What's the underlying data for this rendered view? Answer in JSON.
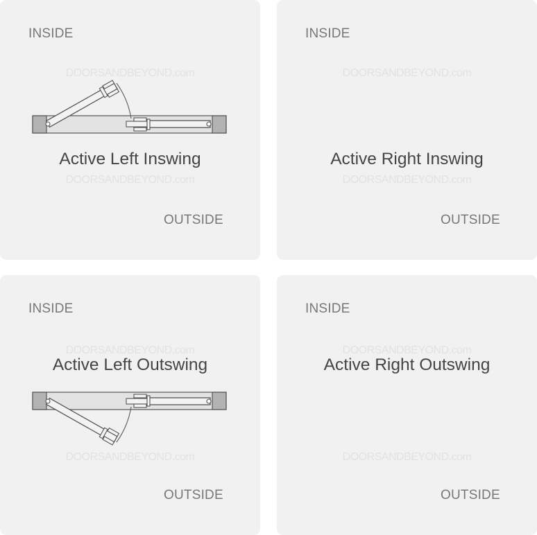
{
  "watermark": "DOORSANDBEYOND.com",
  "panels": [
    {
      "inside": "INSIDE",
      "outside": "OUTSIDE",
      "title": "Active Left Inswing"
    },
    {
      "inside": "INSIDE",
      "outside": "OUTSIDE",
      "title": "Active Right Inswing"
    },
    {
      "inside": "INSIDE",
      "outside": "OUTSIDE",
      "title": "Active Left Outswing"
    },
    {
      "inside": "INSIDE",
      "outside": "OUTSIDE",
      "title": "Active Right Outswing"
    }
  ]
}
